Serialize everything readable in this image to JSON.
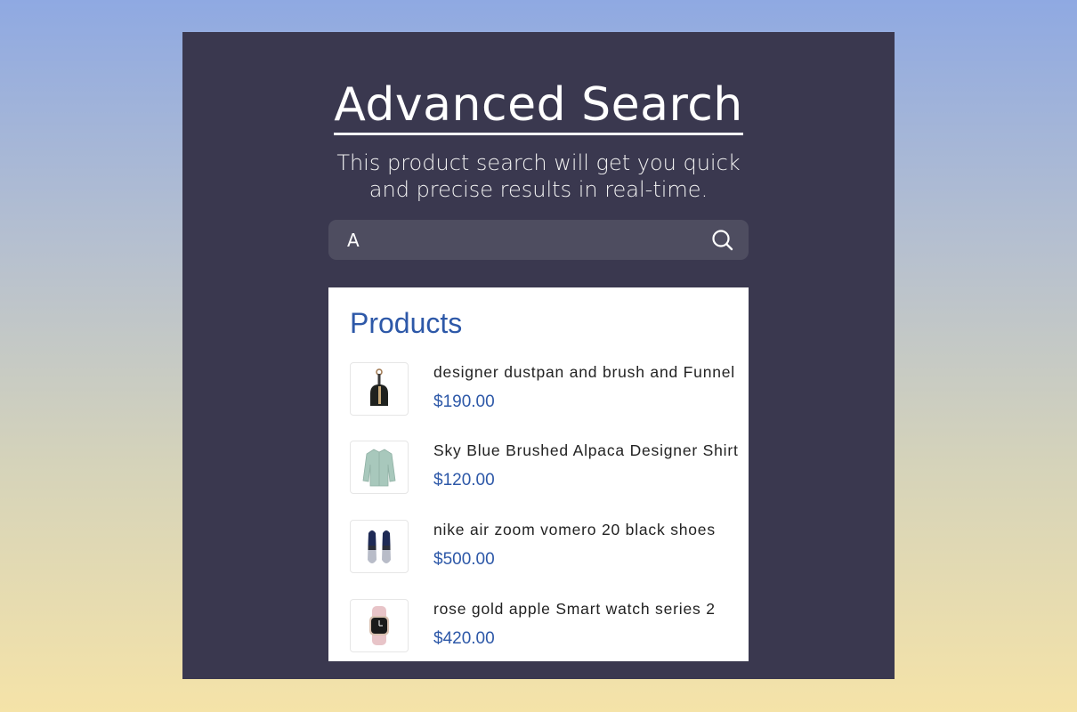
{
  "header": {
    "title": "Advanced Search",
    "subtitle_line1": "This product search will get you quick",
    "subtitle_line2": "and precise results in real-time."
  },
  "search": {
    "value": "A",
    "icon": "search-icon"
  },
  "results": {
    "heading": "Products",
    "items": [
      {
        "name": "designer dustpan and brush and Funnel",
        "price": "$190.00",
        "image": "dustpan-image"
      },
      {
        "name": "Sky Blue Brushed Alpaca Designer Shirt",
        "price": "$120.00",
        "image": "shirt-image"
      },
      {
        "name": "nike air zoom vomero 20 black shoes",
        "price": "$500.00",
        "image": "shoes-image"
      },
      {
        "name": "rose gold apple Smart watch series 2",
        "price": "$420.00",
        "image": "watch-image"
      }
    ]
  },
  "colors": {
    "panel": "#3a384f",
    "search_bg": "#4e4d60",
    "accent": "#2d58a8"
  }
}
